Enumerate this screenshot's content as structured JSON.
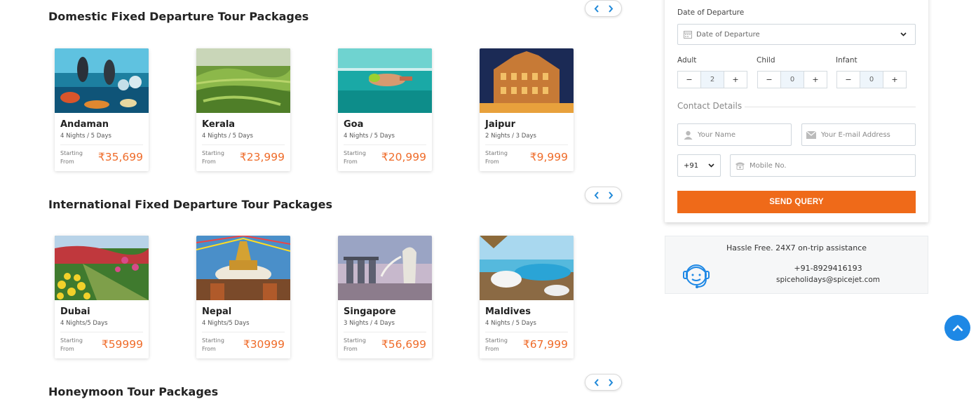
{
  "sections": [
    {
      "title": "Domestic Fixed Departure Tour Packages",
      "cards": [
        {
          "name": "Andaman",
          "duration": "4 Nights / 5 Days",
          "starting": "Starting",
          "from": "From",
          "price": "₹35,699"
        },
        {
          "name": "Kerala",
          "duration": "4 Nights / 5 Days",
          "starting": "Starting",
          "from": "From",
          "price": "₹23,999"
        },
        {
          "name": "Goa",
          "duration": "4 Nights / 5 Days",
          "starting": "Starting",
          "from": "From",
          "price": "₹20,999"
        },
        {
          "name": "Jaipur",
          "duration": "2 Nights / 3 Days",
          "starting": "Starting",
          "from": "From",
          "price": "₹9,999"
        }
      ]
    },
    {
      "title": "International Fixed Departure Tour Packages",
      "cards": [
        {
          "name": "Dubai",
          "duration": "4 Nights/5 Days",
          "starting": "Starting",
          "from": "From",
          "price": "₹59999"
        },
        {
          "name": "Nepal",
          "duration": "4 Nights/5 Days",
          "starting": "Starting",
          "from": "From",
          "price": "₹30999"
        },
        {
          "name": "Singapore",
          "duration": "3 Nights / 4 Days",
          "starting": "Starting",
          "from": "From",
          "price": "₹56,699"
        },
        {
          "name": "Maldives",
          "duration": "4 Nights / 5 Days",
          "starting": "Starting",
          "from": "From",
          "price": "₹67,999"
        }
      ]
    },
    {
      "title": "Honeymoon Tour Packages",
      "cards": []
    }
  ],
  "form": {
    "date_label": "Date of Departure",
    "date_placeholder": "Date of Departure",
    "adult_label": "Adult",
    "child_label": "Child",
    "infant_label": "Infant",
    "adult_value": "2",
    "child_value": "0",
    "infant_value": "0",
    "minus": "−",
    "plus": "+",
    "contact_heading": "Contact Details",
    "name_placeholder": "Your Name",
    "email_placeholder": "Your E-mail Address",
    "country_code": "+91",
    "mobile_placeholder": "Mobile No.",
    "submit_label": "SEND QUERY"
  },
  "assistance": {
    "title": "Hassle Free. 24X7 on-trip assistance",
    "phone": "+91-8929416193",
    "email": "spiceholidays@spicejet.com"
  },
  "colors": {
    "accent": "#ef6a19",
    "price": "#ef6c2a",
    "link_blue": "#1e88e5"
  },
  "icons": [
    "chevron-left-icon",
    "chevron-right-icon",
    "calendar-icon",
    "chevron-down-icon",
    "user-icon",
    "mail-icon",
    "phone-icon",
    "support-agent-icon",
    "arrow-up-icon"
  ]
}
